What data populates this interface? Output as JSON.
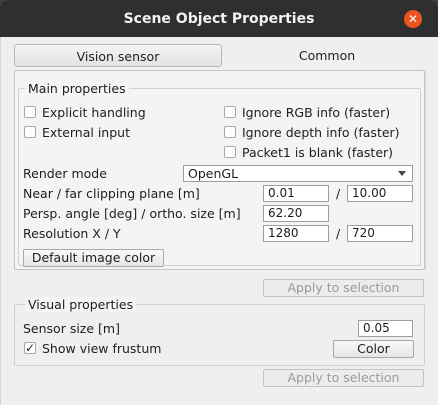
{
  "window": {
    "title": "Scene Object Properties",
    "close_glyph": "✕"
  },
  "tabs": [
    {
      "label": "Vision sensor",
      "active": true
    },
    {
      "label": "Common",
      "active": false
    }
  ],
  "main_properties": {
    "title": "Main properties",
    "checkboxes_left": [
      {
        "label": "Explicit handling",
        "checked": false
      },
      {
        "label": "External input",
        "checked": false
      }
    ],
    "checkboxes_right": [
      {
        "label": "Ignore RGB info (faster)",
        "checked": false
      },
      {
        "label": "Ignore depth  info (faster)",
        "checked": false
      },
      {
        "label": "Packet1 is blank (faster)",
        "checked": false
      }
    ],
    "render_mode": {
      "label": "Render mode",
      "value": "OpenGL"
    },
    "clipping": {
      "label": "Near / far clipping plane [m]",
      "near": "0.01",
      "far": "10.00",
      "separator": "/"
    },
    "persp_angle": {
      "label": "Persp. angle [deg] / ortho. size [m]",
      "value": "62.20"
    },
    "resolution": {
      "label": "Resolution X / Y",
      "x": "1280",
      "y": "720",
      "separator": "/"
    },
    "default_color_button": "Default image color",
    "apply_button": "Apply to selection"
  },
  "visual_properties": {
    "title": "Visual properties",
    "sensor_size": {
      "label": "Sensor size [m]",
      "value": "0.05"
    },
    "show_frustum": {
      "label": "Show view frustum",
      "checked": true
    },
    "color_button": "Color",
    "apply_button": "Apply to selection"
  },
  "colors": {
    "titlebar": "#2f2f2f",
    "close_button": "#e9541f",
    "background": "#efefef"
  }
}
